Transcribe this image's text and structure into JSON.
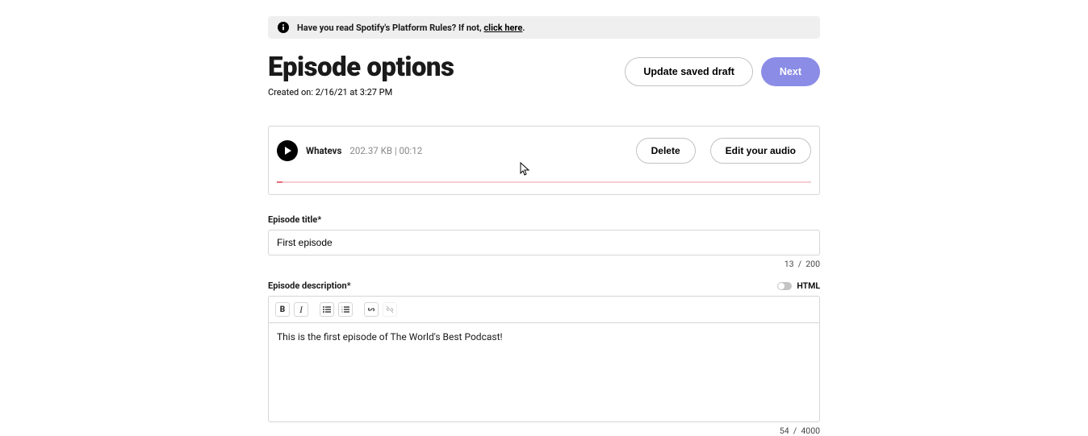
{
  "banner": {
    "text_before": "Have you read Spotify's Platform Rules? If not, ",
    "link_text": "click here",
    "text_after": "."
  },
  "header": {
    "title": "Episode options",
    "created_label": "Created on: 2/16/21 at 3:27 PM"
  },
  "actions": {
    "update_draft": "Update saved draft",
    "next": "Next"
  },
  "audio": {
    "title": "Whatevs",
    "meta": "202.37 KB | 00:12",
    "delete": "Delete",
    "edit": "Edit your audio"
  },
  "fields": {
    "title_label": "Episode title*",
    "title_value": "First episode",
    "title_count": "13",
    "title_sep": "/",
    "title_max": "200",
    "desc_label": "Episode description*",
    "html_label": "HTML",
    "desc_value": "This is the first episode of The World's Best Podcast!",
    "desc_count": "54",
    "desc_sep": "/",
    "desc_max": "4000"
  },
  "toolbar": {
    "bold": "B",
    "italic": "I"
  }
}
